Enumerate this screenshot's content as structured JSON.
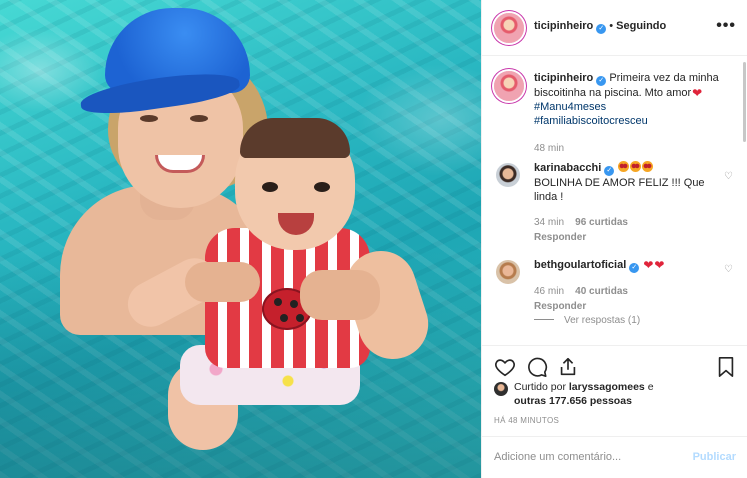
{
  "post": {
    "username": "ticipinheiro",
    "follow_separator": "•",
    "follow_status": "Seguindo",
    "more_label": "•••"
  },
  "caption": {
    "username": "ticipinheiro",
    "text": "Primeira vez da minha biscoitinha na piscina. Mto amor",
    "tag1": "#Manu4meses",
    "tag2": "#familiabiscoitocresceu",
    "time": "48 min"
  },
  "comments": [
    {
      "username": "karinabacchi",
      "text": "BOLINHA DE AMOR FELIZ !!! Que linda !",
      "time": "34 min",
      "likes": "96 curtidas",
      "reply": "Responder"
    },
    {
      "username": "bethgoulartoficial",
      "time": "46 min",
      "likes": "40 curtidas",
      "reply": "Responder",
      "view_replies": "Ver respostas (1)"
    }
  ],
  "likes": {
    "prefix": "Curtido por",
    "user": "laryssagomees",
    "connector": "e",
    "others": "outras 177.656 pessoas"
  },
  "timestamp": "HÁ 48 MINUTOS",
  "comment_box": {
    "placeholder": "Adicione um comentário...",
    "publish": "Publicar"
  },
  "colors": {
    "link": "#00376b",
    "meta": "#8e8e8e",
    "verified": "#3897f0",
    "publish_disabled": "#b3dbff"
  }
}
